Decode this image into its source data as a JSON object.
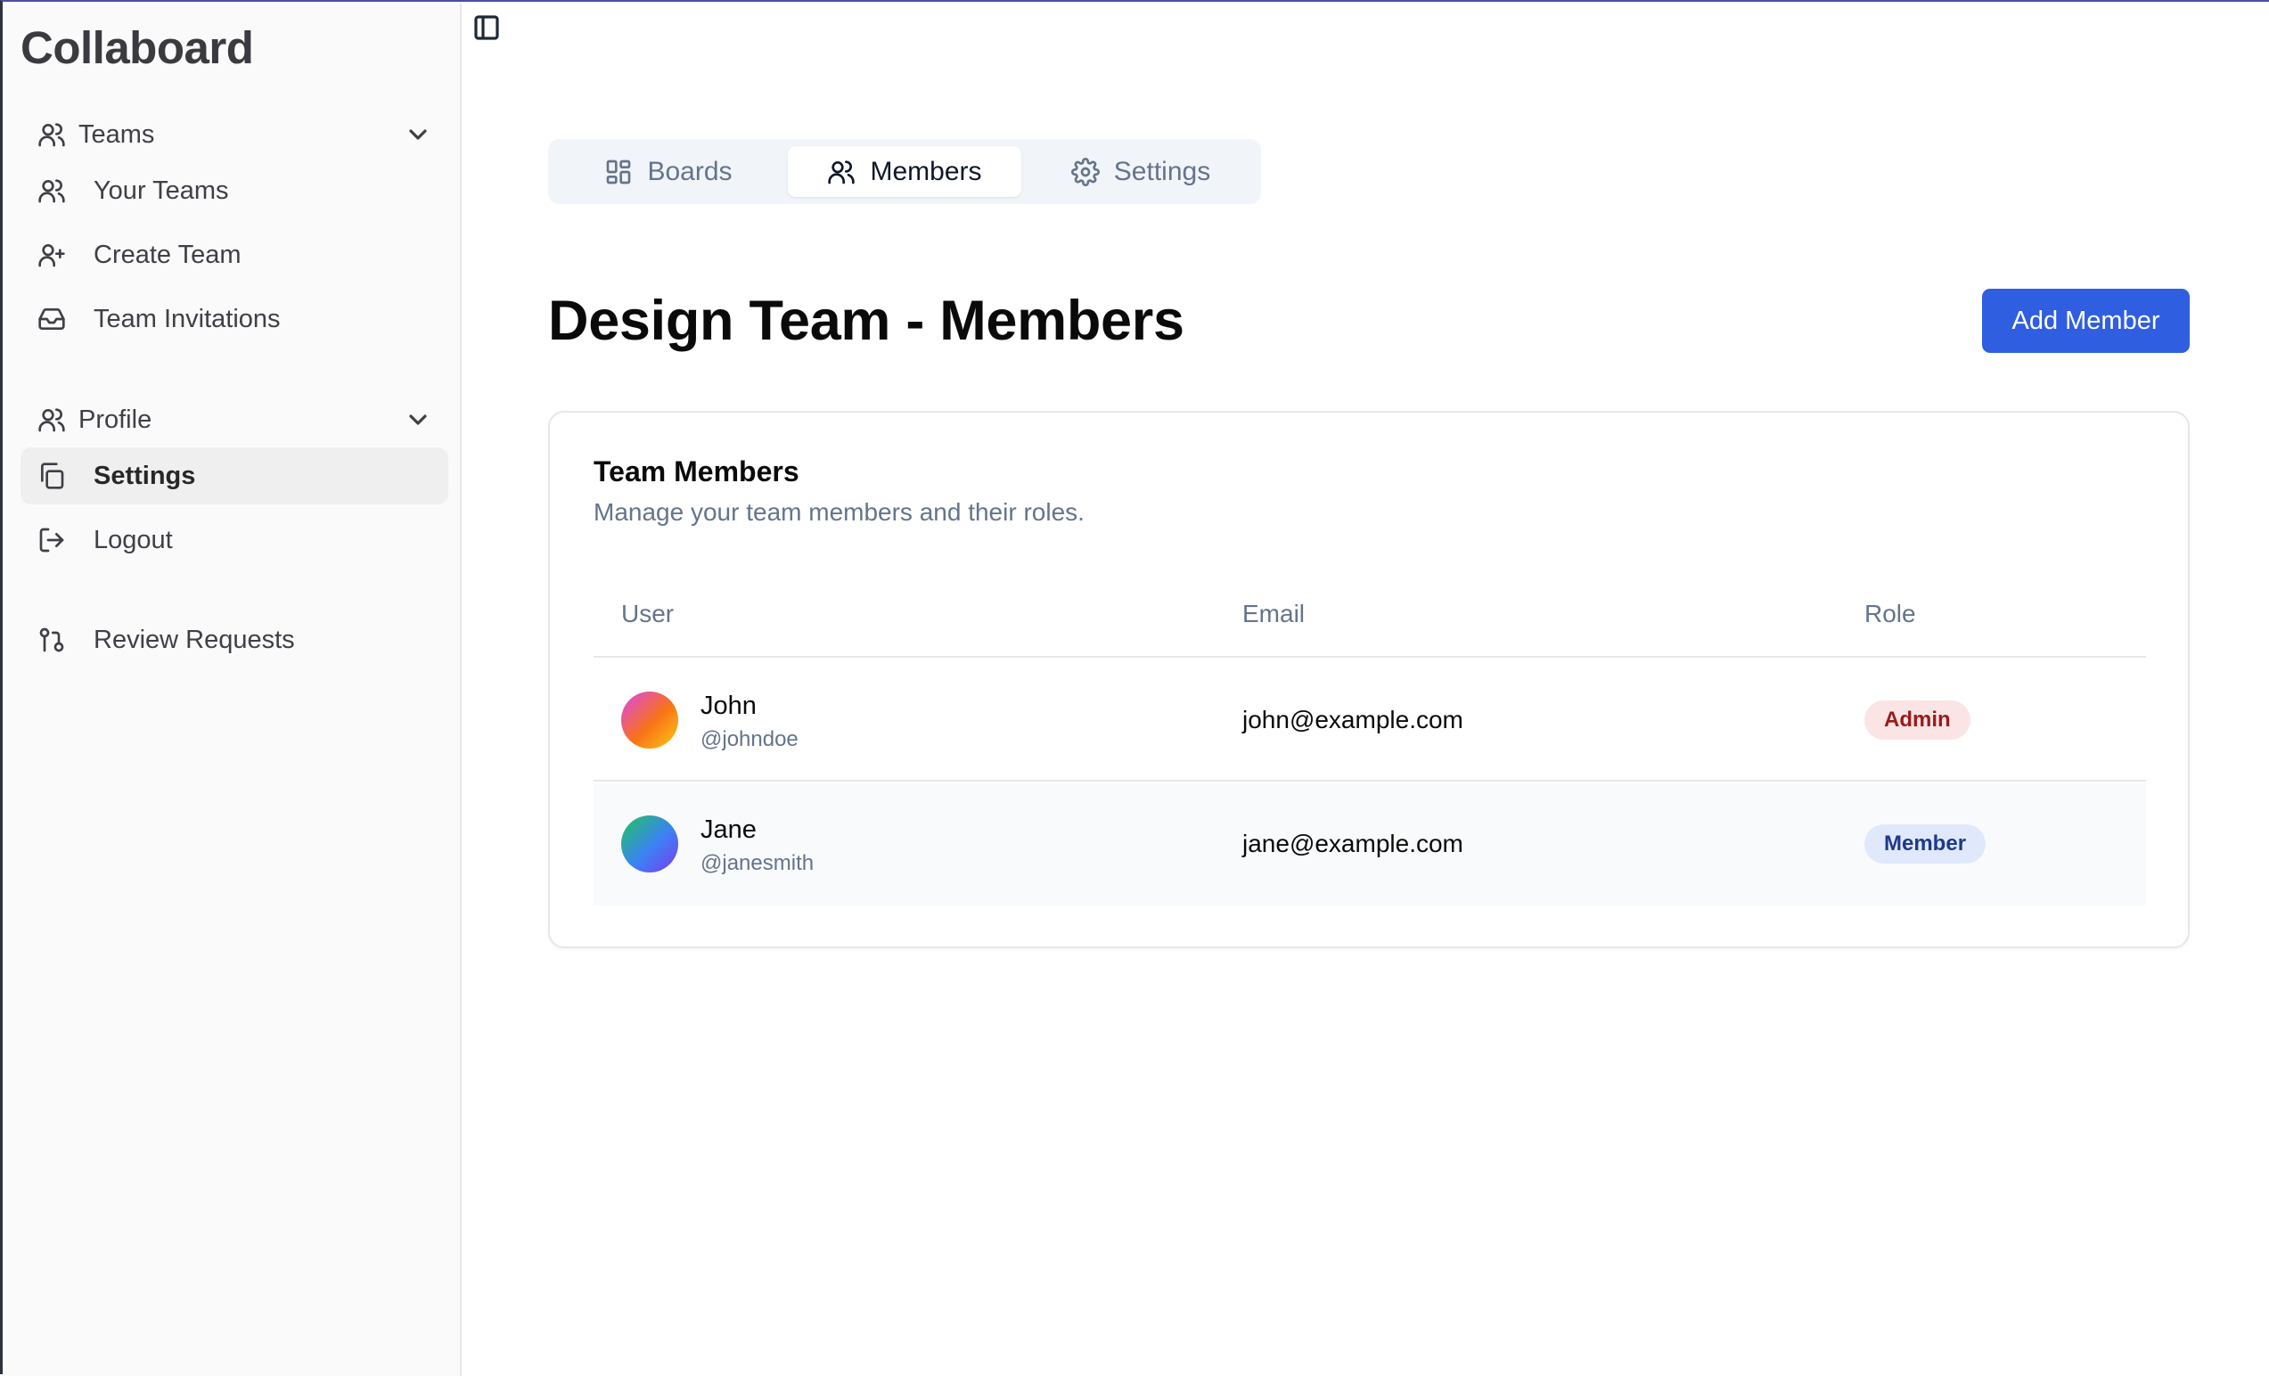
{
  "app": {
    "brand": "Collaboard"
  },
  "sidebar": {
    "groups": [
      {
        "label": "Teams",
        "icon": "users-icon",
        "items": [
          {
            "label": "Your Teams",
            "icon": "users-icon"
          },
          {
            "label": "Create Team",
            "icon": "user-plus-icon"
          },
          {
            "label": "Team Invitations",
            "icon": "inbox-icon"
          }
        ]
      },
      {
        "label": "Profile",
        "icon": "users-icon",
        "items": [
          {
            "label": "Settings",
            "icon": "copy-icon",
            "active": true
          },
          {
            "label": "Logout",
            "icon": "logout-icon"
          }
        ]
      }
    ],
    "extra": {
      "label": "Review Requests",
      "icon": "git-pull-request-icon"
    }
  },
  "tabs": [
    {
      "label": "Boards",
      "icon": "layout-grid-icon",
      "active": false
    },
    {
      "label": "Members",
      "icon": "users-icon",
      "active": true
    },
    {
      "label": "Settings",
      "icon": "settings-icon",
      "active": false
    }
  ],
  "page": {
    "title": "Design Team - Members",
    "add_button_label": "Add Member"
  },
  "card": {
    "title": "Team Members",
    "description": "Manage your team members and their roles.",
    "columns": [
      "User",
      "Email",
      "Role"
    ],
    "members": [
      {
        "name": "John",
        "handle": "@johndoe",
        "email": "john@example.com",
        "role": "Admin"
      },
      {
        "name": "Jane",
        "handle": "@janesmith",
        "email": "jane@example.com",
        "role": "Member"
      }
    ]
  },
  "colors": {
    "accent": "#2f5fe0",
    "admin_badge_bg": "#fbe4e4",
    "admin_badge_text": "#991b1b",
    "member_badge_bg": "#e0e9fb",
    "member_badge_text": "#1e3a8a"
  }
}
